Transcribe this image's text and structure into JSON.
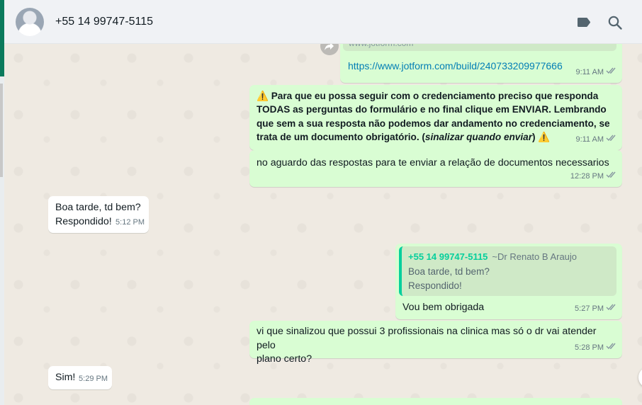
{
  "header": {
    "contact_name": "+55 14 99747-5115",
    "icons": [
      "label-icon",
      "search-icon"
    ]
  },
  "messages": {
    "link_preview": {
      "url_small": "www.jotform.com",
      "link": "https://www.jotform.com/build/240733209977666",
      "time": "9:11 AM"
    },
    "warning": {
      "text_1": "Para que eu possa seguir com o credenciamento preciso que responda",
      "text_2": "TODAS as perguntas do formulário e no final clique em ENVIAR. Lembrando",
      "text_3": "que sem a sua resposta não podemos dar andamento no credenciamento, se",
      "text_4a": "trata de um documento obrigatório. (",
      "text_4b": "sinalizar quando enviar",
      "text_4c": ")",
      "time": "9:11 AM"
    },
    "aguardo": {
      "text": "no aguardo das respostas para te enviar a relação de documentos necessarios",
      "time": "12:28 PM"
    },
    "boa_tarde": {
      "line_1": "Boa tarde, td bem?",
      "line_2": "Respondido!",
      "time": "5:12 PM"
    },
    "reply": {
      "quote_name": "+55 14 99747-5115",
      "quote_author": "~Dr Renato B Araujo",
      "quote_line_1": "Boa tarde, td bem?",
      "quote_line_2": "Respondido!",
      "text": "Vou bem obrigada",
      "time": "5:27 PM"
    },
    "vi_que": {
      "line_1": "vi que sinalizou que possui 3 profissionais na clinica mas só o dr vai atender pelo",
      "line_2": "plano certo?",
      "time": "5:28 PM"
    },
    "sim": {
      "text": "Sim!",
      "time": "5:29 PM"
    }
  },
  "colors": {
    "outgoing_bubble": "#d9fdd3",
    "incoming_bubble": "#ffffff",
    "chat_background": "#efeae2",
    "read_tick": "#53bdeb",
    "quote_accent": "#06cf9c"
  }
}
